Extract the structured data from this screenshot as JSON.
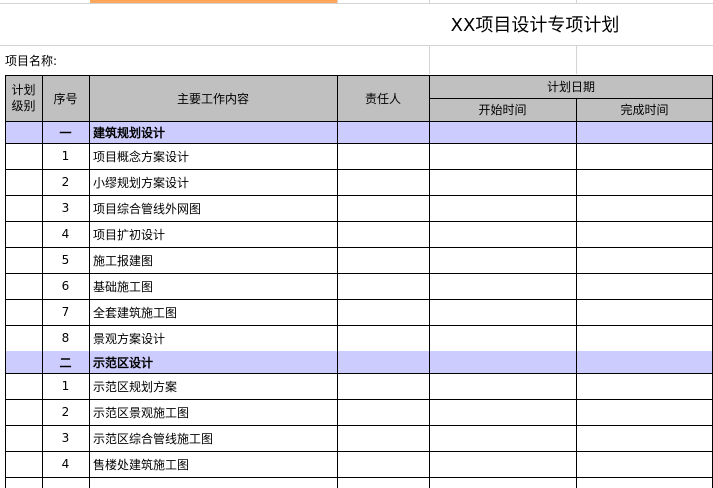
{
  "title": "XX项目设计专项计划",
  "project_name_label": "项目名称:",
  "headers": {
    "plan_level": "计划级别",
    "seq": "序号",
    "content": "主要工作内容",
    "owner": "责任人",
    "plan_date": "计划日期",
    "start": "开始时间",
    "end": "完成时间"
  },
  "rows": [
    {
      "type": "section",
      "seq": "一",
      "content": "建筑规划设计"
    },
    {
      "type": "item",
      "seq": "1",
      "content": "项目概念方案设计"
    },
    {
      "type": "item",
      "seq": "2",
      "content": "小缪规划方案设计"
    },
    {
      "type": "item",
      "seq": "3",
      "content": "项目综合管线外网图"
    },
    {
      "type": "item",
      "seq": "4",
      "content": "项目扩初设计"
    },
    {
      "type": "item",
      "seq": "5",
      "content": "施工报建图"
    },
    {
      "type": "item",
      "seq": "6",
      "content": "基础施工图"
    },
    {
      "type": "item",
      "seq": "7",
      "content": "全套建筑施工图"
    },
    {
      "type": "item",
      "seq": "8",
      "content": "景观方案设计"
    },
    {
      "type": "section",
      "seq": "二",
      "content": "示范区设计"
    },
    {
      "type": "item",
      "seq": "1",
      "content": "示范区规划方案"
    },
    {
      "type": "item",
      "seq": "2",
      "content": "示范区景观施工图"
    },
    {
      "type": "item",
      "seq": "3",
      "content": "示范区综合管线施工图"
    },
    {
      "type": "item",
      "seq": "4",
      "content": "售楼处建筑施工图"
    }
  ],
  "colors": {
    "header_bg": "#c0c0c0",
    "section_bg": "#ccccff",
    "selected_cell_fill": "#ffa65a",
    "gridline": "#d4d4d4"
  }
}
